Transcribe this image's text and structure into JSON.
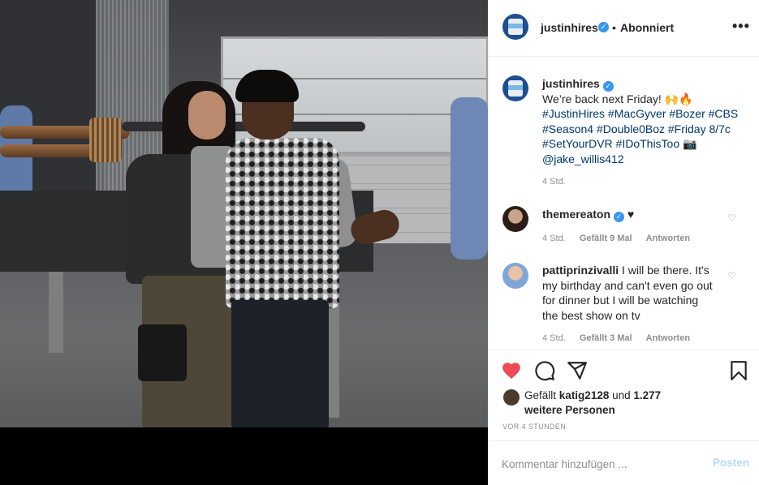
{
  "post": {
    "author": "justinhires",
    "follow_state": "Abonniert",
    "more_icon": "more-horizontal-icon",
    "caption": {
      "user": "justinhires",
      "text": "We’re back next Friday! 🙌🔥",
      "tags": "#JustinHires #MacGyver #Bozer #CBS #Season4 #Double0Boz #Friday 8/7c #SetYourDVR #IDoThisToo 📷 @jake_willis412",
      "time": "4 Std."
    },
    "comments": [
      {
        "user": "themereaton",
        "verified": true,
        "text": "♥",
        "time": "4 Std.",
        "likes": "Gefällt 9 Mal",
        "reply": "Antworten"
      },
      {
        "user": "pattiprinzivalli",
        "verified": false,
        "text": "I will be there. It's my birthday and can't even go out for dinner but I will be watching the best show on tv",
        "time": "4 Std.",
        "likes": "Gefällt 3 Mal",
        "reply": "Antworten"
      }
    ],
    "likes": {
      "prefix": "Gefällt",
      "user": "katig2128",
      "suffix": "und",
      "others": "1.277 weitere Personen"
    },
    "posted_ago": "VOR 4 STUNDEN",
    "comment_placeholder": "Kommentar hinzufügen ...",
    "post_button": "Posten"
  },
  "colors": {
    "like_red": "#ed4956",
    "link_blue": "#00376b",
    "verified_blue": "#3897f0",
    "muted": "#8e8e8e",
    "post_disabled": "#b3dbff"
  }
}
